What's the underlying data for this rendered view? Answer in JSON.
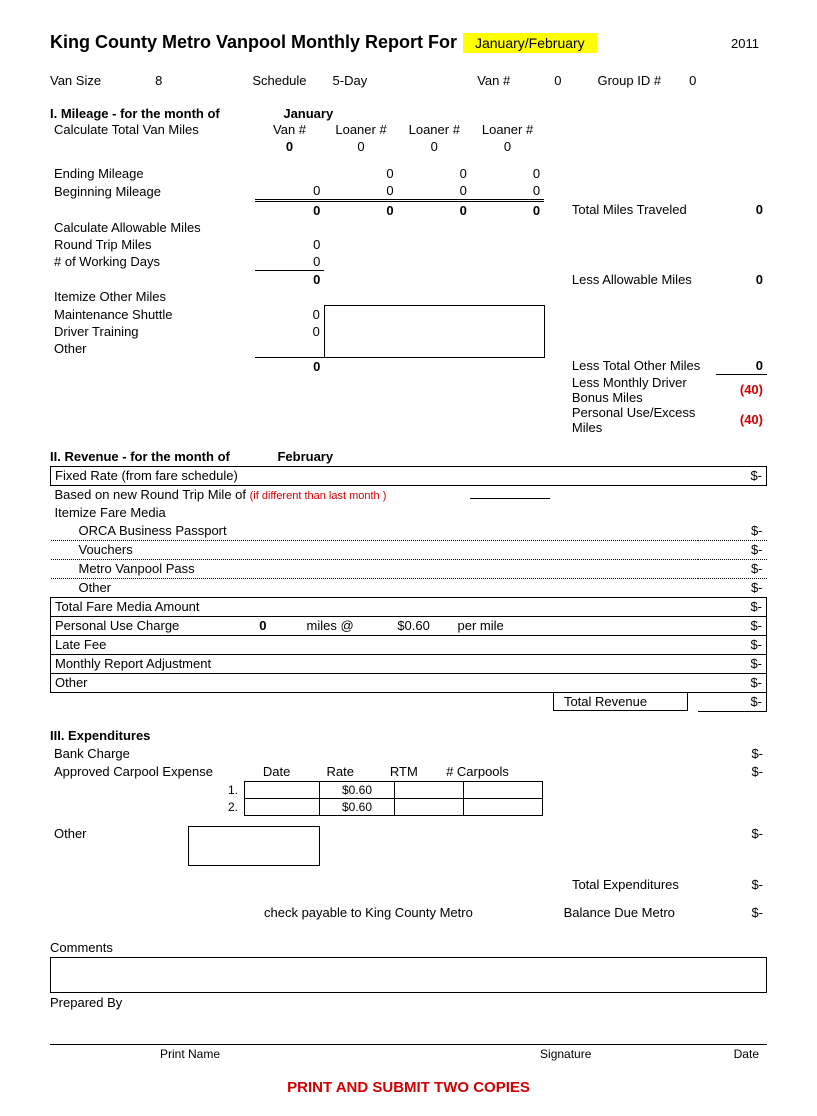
{
  "title_prefix": "King County Metro Vanpool Monthly Report For",
  "period": "January/February",
  "year": "2011",
  "info": {
    "van_size_label": "Van Size",
    "van_size": "8",
    "schedule_label": "Schedule",
    "schedule": "5-Day",
    "van_num_label": "Van #",
    "van_num": "0",
    "group_id_label": "Group ID #",
    "group_id": "0"
  },
  "mileage": {
    "heading": "I.  Mileage - for the month of",
    "month": "January",
    "calc_total": "Calculate Total Van Miles",
    "col_van": "Van #",
    "col_loaner": "Loaner #",
    "van_val": "0",
    "l1": "0",
    "l2": "0",
    "l3": "0",
    "ending": "Ending Mileage",
    "begin": "Beginning Mileage",
    "end_l1": "0",
    "end_l2": "0",
    "end_l3": "0",
    "beg_van": "0",
    "beg_l1": "0",
    "beg_l2": "0",
    "beg_l3": "0",
    "sum_van": "0",
    "sum_l1": "0",
    "sum_l2": "0",
    "sum_l3": "0",
    "total_miles_label": "Total Miles Traveled",
    "total_miles": "0",
    "calc_allow": "Calculate Allowable Miles",
    "rtm": "Round Trip Miles",
    "rtm_v": "0",
    "wdays": "# of Working Days",
    "wdays_v": "0",
    "wdays_sum": "0",
    "less_allow_label": "Less Allowable Miles",
    "less_allow": "0",
    "itemize": "Itemize Other Miles",
    "maint": "Maintenance Shuttle",
    "maint_v": "0",
    "driver": "Driver Training",
    "driver_v": "0",
    "other": "Other",
    "other_sum": "0",
    "less_other_label": "Less Total Other Miles",
    "less_other": "0",
    "bonus_label": "Less Monthly Driver Bonus Miles",
    "bonus": "(40)",
    "excess_label": "Personal Use/Excess Miles",
    "excess": "(40)"
  },
  "revenue": {
    "heading": "II.  Revenue -  for the month of",
    "month": "February",
    "fixed": "Fixed Rate (from fare schedule)",
    "based": "Based on new Round Trip Mile of",
    "diff_note": "(if different than last month )",
    "itemize": "Itemize Fare Media",
    "orca": "ORCA Business Passport",
    "vouchers": "Vouchers",
    "pass": "Metro Vanpool Pass",
    "other": "Other",
    "total_fare": "Total Fare Media Amount",
    "personal": "Personal Use Charge",
    "personal_miles": "0",
    "miles_at": "miles @",
    "rate": "$0.60",
    "per_mile": "per mile",
    "late": "Late Fee",
    "adj": "Monthly Report Adjustment",
    "other2": "Other",
    "total_rev_label": "Total Revenue",
    "dash": "$-"
  },
  "exp": {
    "heading": "III.  Expenditures",
    "bank": "Bank Charge",
    "approved": "Approved Carpool Expense",
    "date": "Date",
    "rate": "Rate",
    "rtm": "RTM",
    "carpools": "# Carpools",
    "n1": "1.",
    "n2": "2.",
    "rate_v": "$0.60",
    "other": "Other",
    "total_exp_label": "Total Expenditures",
    "check": "check payable to King County Metro",
    "balance": "Balance Due Metro",
    "dash": "$-"
  },
  "comments_label": "Comments",
  "prepared": "Prepared By",
  "print_name": "Print Name",
  "signature": "Signature",
  "date": "Date",
  "footer": "PRINT AND SUBMIT TWO COPIES"
}
